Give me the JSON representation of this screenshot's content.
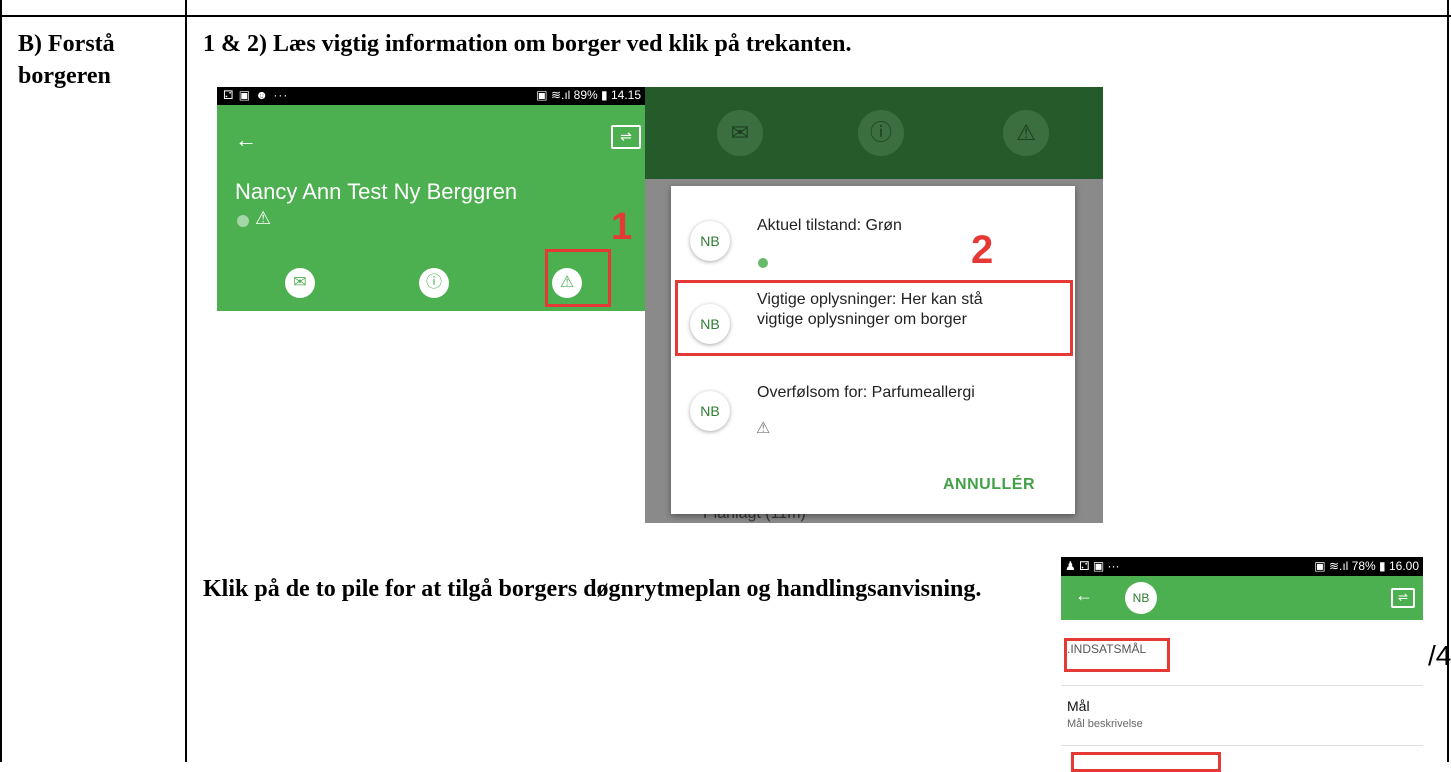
{
  "row_label": "B) Forstå borgeren",
  "heading_1": "1 & 2) Læs vigtig information om borger ved klik på trekanten.",
  "heading_2": "Klik på de to pile for at tilgå borgers døgnrytmeplan og handlingsanvisning.",
  "page_fragment": "/4",
  "screenshot_1": {
    "status_left": "⚁ ▣ ☻ ···",
    "status_right": "▣ ≋.ıl 89% ▮ 14.15",
    "back_icon": "arrow-left-icon",
    "citizen_name": "Nancy Ann Test Ny Berggren",
    "marker_number": "1",
    "action_icons": [
      "mail-icon",
      "info-icon",
      "warning-icon"
    ]
  },
  "screenshot_2": {
    "marker_number": "2",
    "avatar_initials": "NB",
    "items": [
      {
        "text": "Aktuel tilstand: Grøn"
      },
      {
        "text": "Vigtige oplysninger: Her kan stå vigtige oplysninger om borger"
      },
      {
        "text": "Overfølsom for: Parfumeallergi"
      }
    ],
    "background_text": "Planlagt (11m)",
    "cancel_label": "ANNULLÉR"
  },
  "screenshot_3": {
    "status_left": "♟ ⚁ ▣ ···",
    "status_right": "▣ ≋.ıl 78% ▮ 16.00",
    "avatar_initials": "NB",
    "section_label": ".INDSATSMÅL",
    "goal_title": "Mål",
    "goal_desc": "Mål beskrivelse"
  },
  "colors": {
    "app_green": "#4caf50",
    "dark_green": "#255b2a",
    "highlight_red": "#e53935"
  }
}
